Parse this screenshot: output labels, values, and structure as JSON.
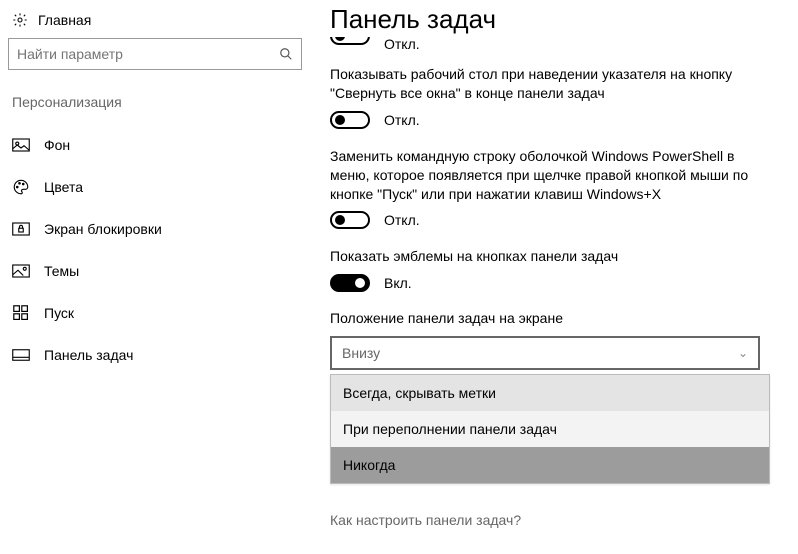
{
  "sidebar": {
    "home_label": "Главная",
    "search_placeholder": "Найти параметр",
    "category": "Персонализация",
    "items": [
      {
        "label": "Фон"
      },
      {
        "label": "Цвета"
      },
      {
        "label": "Экран блокировки"
      },
      {
        "label": "Темы"
      },
      {
        "label": "Пуск"
      },
      {
        "label": "Панель задач"
      }
    ]
  },
  "main": {
    "title": "Панель задач",
    "cutoff_state": "Откл.",
    "settings": [
      {
        "description": "Показывать рабочий стол при наведении указателя на кнопку \"Свернуть все окна\" в конце панели задач",
        "state_label": "Откл.",
        "on": false
      },
      {
        "description": "Заменить командную строку оболочкой Windows PowerShell в меню, которое появляется при щелчке правой кнопкой мыши по кнопке \"Пуск\" или при нажатии клавиш Windows+X",
        "state_label": "Откл.",
        "on": false
      },
      {
        "description": "Показать эмблемы на кнопках панели задач",
        "state_label": "Вкл.",
        "on": true
      }
    ],
    "position_label": "Положение панели задач на экране",
    "select_value": "Внизу",
    "dropdown_options": [
      "Всегда, скрывать метки",
      "При переполнении панели задач",
      "Никогда"
    ],
    "help_link": "Как настроить панели задач?"
  }
}
